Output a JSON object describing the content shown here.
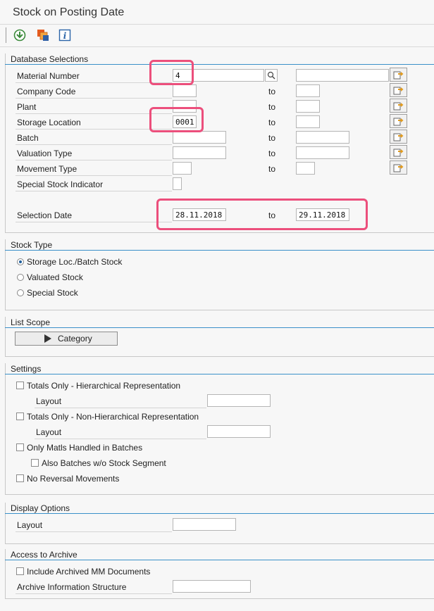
{
  "window": {
    "title": "Stock on Posting Date"
  },
  "toolbar": {
    "icons": [
      "execute-icon",
      "multiple-selection-icon",
      "info-icon"
    ]
  },
  "db_selections": {
    "title": "Database Selections",
    "to_label": "to",
    "rows": [
      {
        "label": "Material Number",
        "from": "4",
        "to": ""
      },
      {
        "label": "Company Code",
        "from": "",
        "to": ""
      },
      {
        "label": "Plant",
        "from": "",
        "to": ""
      },
      {
        "label": "Storage Location",
        "from": "0001",
        "to": ""
      },
      {
        "label": "Batch",
        "from": "",
        "to": ""
      },
      {
        "label": "Valuation Type",
        "from": "",
        "to": ""
      },
      {
        "label": "Movement Type",
        "from": "",
        "to": ""
      },
      {
        "label": "Special Stock Indicator",
        "from": ""
      }
    ],
    "selection_date": {
      "label": "Selection Date",
      "from": "28.11.2018",
      "to": "29.11.2018"
    }
  },
  "stock_type": {
    "title": "Stock Type",
    "options": [
      "Storage Loc./Batch Stock",
      "Valuated Stock",
      "Special Stock"
    ],
    "selected": "Storage Loc./Batch Stock"
  },
  "list_scope": {
    "title": "List Scope",
    "button": "Category"
  },
  "settings": {
    "title": "Settings",
    "totals_hier": "Totals Only - Hierarchical Representation",
    "layout_label": "Layout",
    "totals_nonhier": "Totals Only - Non-Hierarchical Representation",
    "only_batches": "Only Matls Handled in Batches",
    "batches_wo_segment": "Also Batches w/o Stock Segment",
    "no_reversal": "No Reversal Movements"
  },
  "display_options": {
    "title": "Display Options",
    "layout_label": "Layout",
    "layout_value": ""
  },
  "archive": {
    "title": "Access to Archive",
    "include_archived": "Include Archived MM Documents",
    "info_structure_label": "Archive Information Structure",
    "info_structure_value": ""
  },
  "colors": {
    "accent": "#3a90c9",
    "highlight": "#ec4f7c"
  }
}
